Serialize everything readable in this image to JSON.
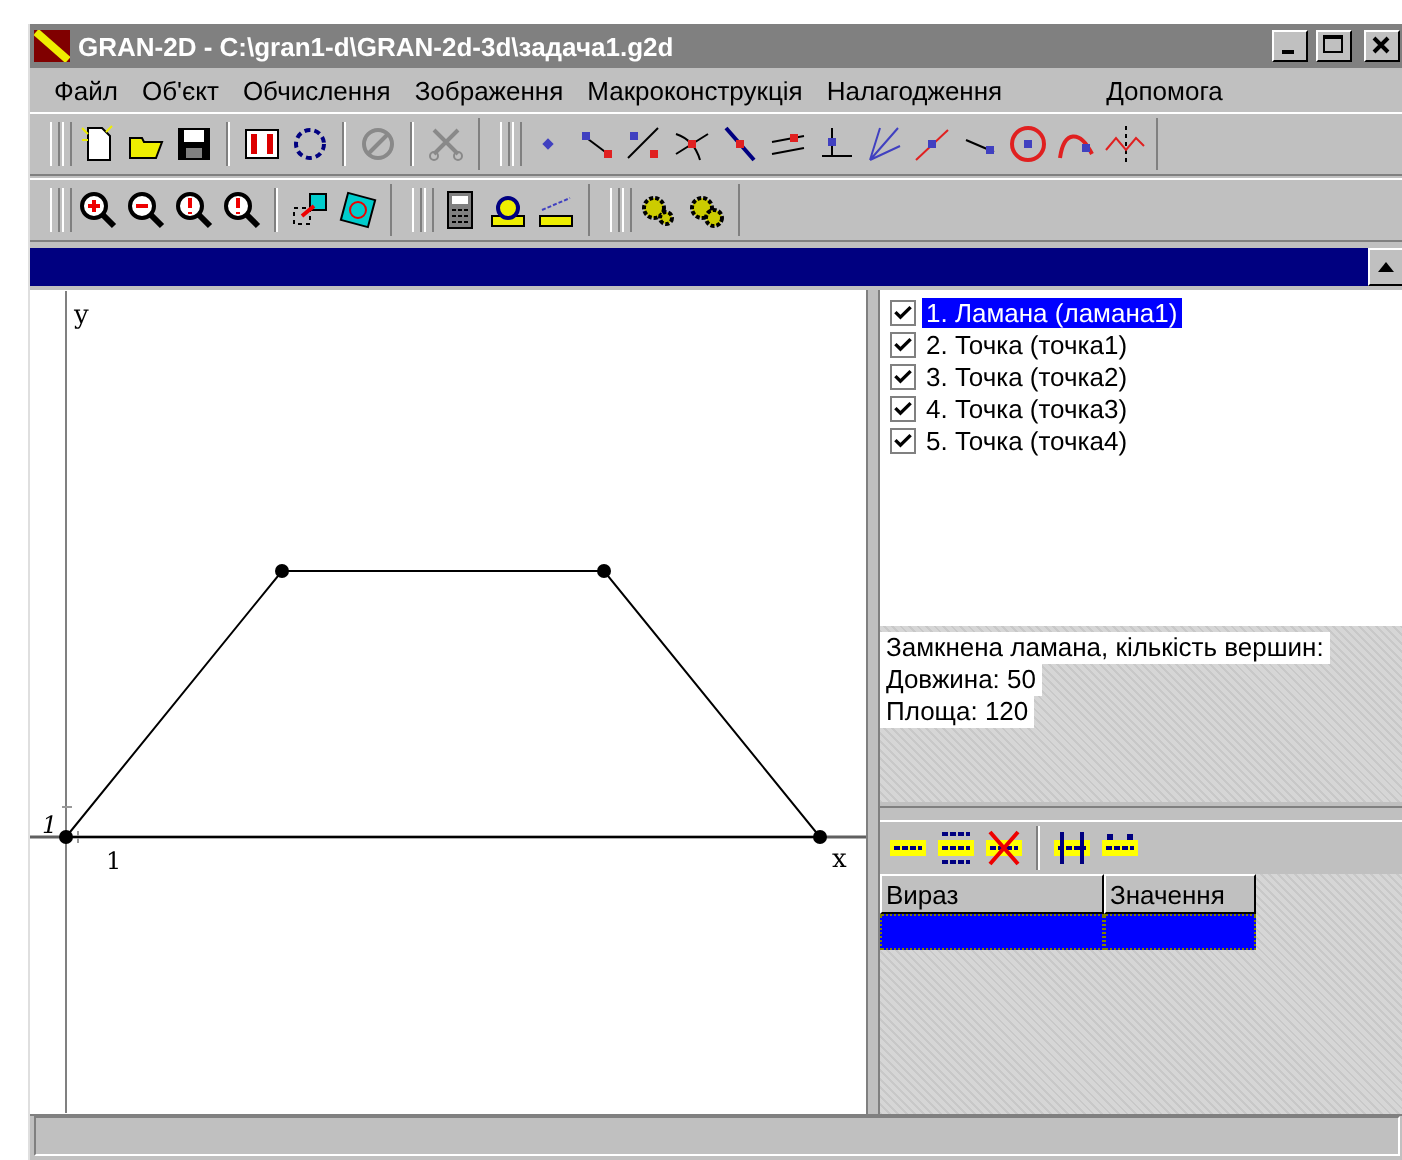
{
  "window": {
    "title": "GRAN-2D - C:\\gran1-d\\GRAN-2d-3d\\задача1.g2d"
  },
  "menu": [
    "Файл",
    "Об'єкт",
    "Обчислення",
    "Зображення",
    "Макроконструкція",
    "Налагодження",
    "Допомога"
  ],
  "toolbars": [
    [
      [
        {
          "kind": "new",
          "disabled": false
        },
        {
          "kind": "open",
          "disabled": false
        },
        {
          "kind": "save",
          "disabled": false
        }
      ],
      [
        {
          "kind": "film",
          "disabled": false
        },
        {
          "kind": "cycle",
          "disabled": false
        }
      ],
      [
        {
          "kind": "prohibit",
          "disabled": true
        }
      ],
      [
        {
          "kind": "cut",
          "disabled": true
        }
      ],
      [
        {
          "kind": "point",
          "disabled": false
        },
        {
          "kind": "two-points",
          "disabled": false
        },
        {
          "kind": "divide",
          "disabled": false
        },
        {
          "kind": "intersect",
          "disabled": false
        },
        {
          "kind": "line",
          "disabled": false
        },
        {
          "kind": "parallel",
          "disabled": false
        },
        {
          "kind": "perpendicular",
          "disabled": false
        },
        {
          "kind": "rays",
          "disabled": false
        },
        {
          "kind": "tangent",
          "disabled": false
        },
        {
          "kind": "segment",
          "disabled": false
        },
        {
          "kind": "circle",
          "disabled": false
        },
        {
          "kind": "arc",
          "disabled": false
        },
        {
          "kind": "reflect",
          "disabled": false
        }
      ]
    ],
    [
      [
        {
          "kind": "zoom-in",
          "disabled": false
        },
        {
          "kind": "zoom-out",
          "disabled": false
        },
        {
          "kind": "zoom",
          "disabled": false
        },
        {
          "kind": "zoom-region",
          "disabled": false
        }
      ],
      [
        {
          "kind": "move",
          "disabled": false
        },
        {
          "kind": "rotate",
          "disabled": false
        }
      ],
      [
        {
          "kind": "calculator",
          "disabled": false
        },
        {
          "kind": "measure",
          "disabled": false
        },
        {
          "kind": "ruler",
          "disabled": false
        }
      ],
      [
        {
          "kind": "gear",
          "disabled": false
        },
        {
          "kind": "gears",
          "disabled": false
        }
      ]
    ]
  ],
  "canvas": {
    "axis_labels": {
      "y": "y",
      "x": "x",
      "x_unit": "1",
      "y_unit": "1"
    }
  },
  "objects": [
    {
      "label": "1. Ламана (ламана1)",
      "checked": true,
      "selected": true
    },
    {
      "label": "2. Точка (точка1)",
      "checked": true,
      "selected": false
    },
    {
      "label": "3. Точка (точка2)",
      "checked": true,
      "selected": false
    },
    {
      "label": "4. Точка (точка3)",
      "checked": true,
      "selected": false
    },
    {
      "label": "5. Точка (точка4)",
      "checked": true,
      "selected": false
    }
  ],
  "info": [
    "Замкнена ламана, кількість вершин:",
    "Довжина: 50",
    "Площа: 120"
  ],
  "formula_toolbar": [
    [
      {
        "kind": "add",
        "disabled": false
      },
      {
        "kind": "system",
        "disabled": false
      },
      {
        "kind": "delete",
        "disabled": false
      }
    ],
    [
      {
        "kind": "move-down",
        "disabled": false
      },
      {
        "kind": "move-up",
        "disabled": false
      }
    ]
  ],
  "table": {
    "columns": [
      "Вираз",
      "Значення"
    ],
    "rows": [
      {
        "selected": true
      }
    ]
  }
}
